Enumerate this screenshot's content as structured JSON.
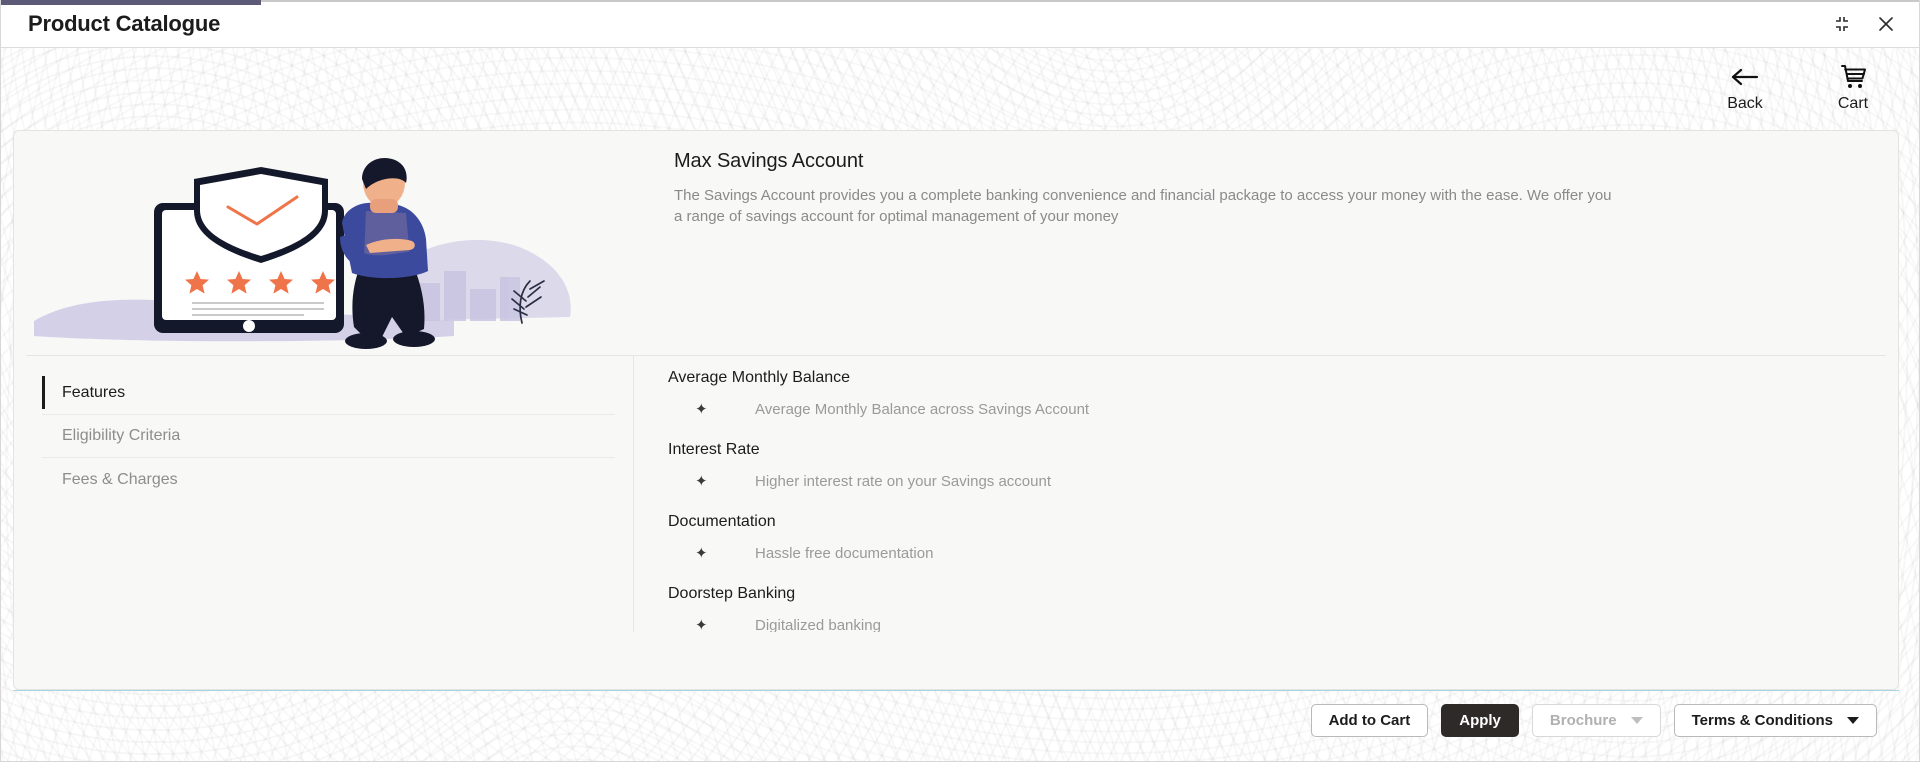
{
  "window": {
    "title": "Product Catalogue",
    "accent_color": "#5c5a77",
    "controls": [
      {
        "name": "restore-down-icon",
        "label": "Restore Down"
      },
      {
        "name": "close-icon",
        "label": "Close"
      }
    ]
  },
  "topbar": {
    "back_label": "Back",
    "cart_label": "Cart"
  },
  "hero": {
    "title": "Max Savings Account",
    "description": "The Savings Account provides you a complete banking convenience and financial package to access your money with the ease. We offer you a range of savings account for optimal management of your money",
    "illustration": {
      "name": "savings-account-illustration",
      "star_color": "#f0744a",
      "jacket_color": "#3c4a9e",
      "blob_color": "#c4c0e0"
    }
  },
  "tabs": [
    {
      "label": "Features",
      "active": true
    },
    {
      "label": "Eligibility Criteria",
      "active": false
    },
    {
      "label": "Fees & Charges",
      "active": false
    }
  ],
  "features": [
    {
      "heading": "Average Monthly Balance",
      "bullet": "✦",
      "items": [
        "Average Monthly Balance across Savings Account"
      ]
    },
    {
      "heading": "Interest Rate",
      "bullet": "✦",
      "items": [
        "Higher interest rate on your Savings account"
      ]
    },
    {
      "heading": "Documentation",
      "bullet": "✦",
      "items": [
        "Hassle free documentation"
      ]
    },
    {
      "heading": "Doorstep Banking",
      "bullet": "✦",
      "items": [
        "Digitalized banking"
      ]
    }
  ],
  "footer": {
    "separator_color": "#a8d4e6",
    "buttons": [
      {
        "label": "Add to Cart",
        "style": "outline",
        "caret": false,
        "disabled": false
      },
      {
        "label": "Apply",
        "style": "primary",
        "caret": false,
        "disabled": false
      },
      {
        "label": "Brochure",
        "style": "outline",
        "caret": true,
        "disabled": true
      },
      {
        "label": "Terms & Conditions",
        "style": "outline",
        "caret": true,
        "disabled": false
      }
    ]
  }
}
